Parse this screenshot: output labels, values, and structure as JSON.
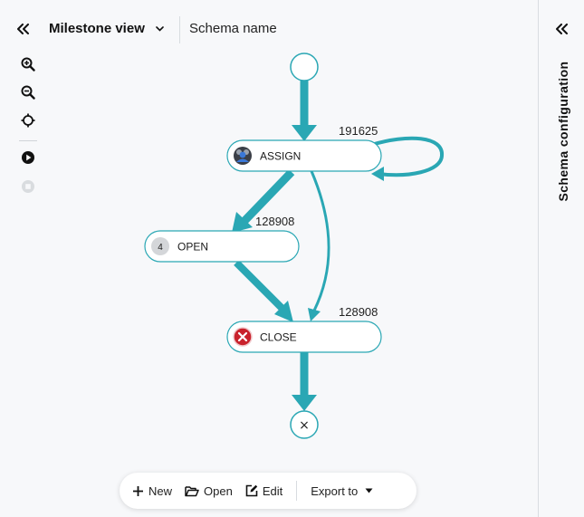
{
  "header": {
    "view_title": "Milestone view",
    "schema_name": "Schema name"
  },
  "toolbar": {
    "items": [
      {
        "icon": "zoom-in-icon"
      },
      {
        "icon": "zoom-out-icon"
      },
      {
        "icon": "center-icon"
      },
      {
        "icon": "play-icon"
      },
      {
        "icon": "stop-icon",
        "disabled": true
      }
    ]
  },
  "right_panel": {
    "title": "Schema configuration"
  },
  "graph": {
    "accent": "#2aa7b4",
    "nodes": [
      {
        "id": "assign",
        "label": "ASSIGN",
        "icon": "users-icon",
        "count": "191625"
      },
      {
        "id": "open",
        "label": "OPEN",
        "badge": "4",
        "count": "128908"
      },
      {
        "id": "close",
        "label": "CLOSE",
        "icon": "error-icon",
        "count": "128908"
      }
    ],
    "end_symbol": "×"
  },
  "bottom_bar": {
    "new_label": "New",
    "open_label": "Open",
    "edit_label": "Edit",
    "export_label": "Export to"
  }
}
